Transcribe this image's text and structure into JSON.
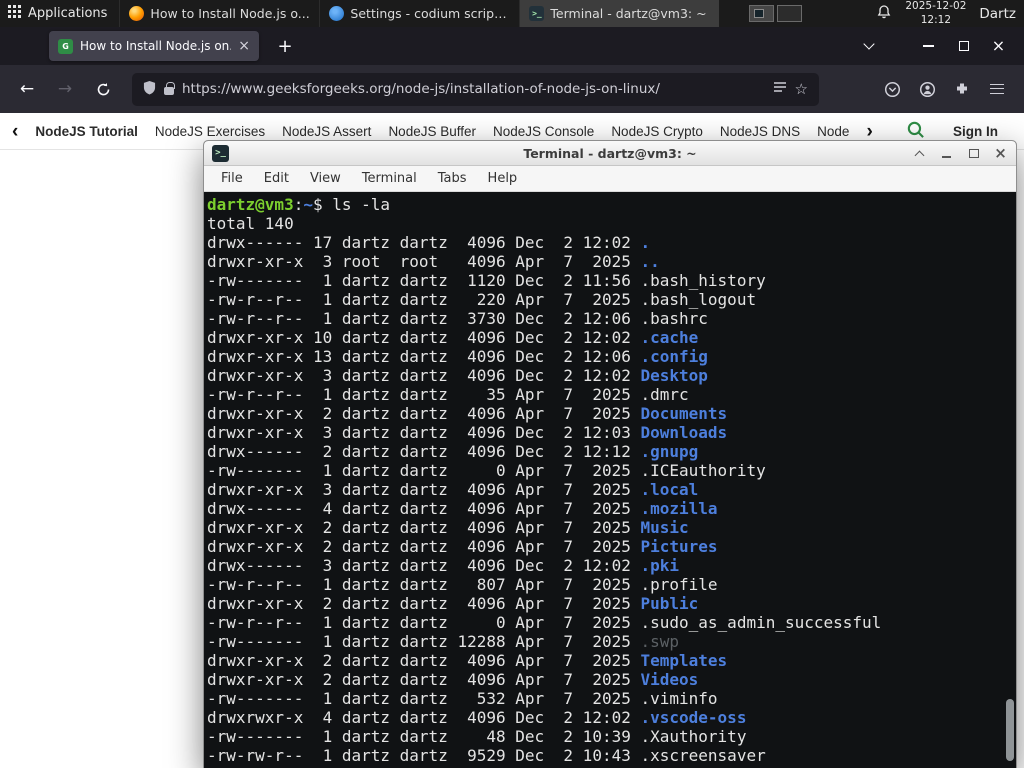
{
  "colors": {
    "gfg_green": "#2f8d46",
    "terminal_dir_blue": "#4d7fdd",
    "terminal_prompt_green": "#7ccf2e",
    "terminal_bg": "#101214",
    "firefox_toolbar": "#2b2a33",
    "panel_bg": "#1b1b1b"
  },
  "panel": {
    "applications_label": "Applications",
    "tasks": [
      {
        "icon": "firefox-icon",
        "title": "How to Install Node.js o..."
      },
      {
        "icon": "codium-icon",
        "title": "Settings - codium script..."
      },
      {
        "icon": "terminal-icon",
        "title": "Terminal - dartz@vm3: ~"
      }
    ],
    "clock": {
      "date": "2025-12-02",
      "time": "12:12"
    },
    "user_label": "Dartz"
  },
  "browser": {
    "tab_title": "How to Install Node.js on...",
    "favicon_letter": "G",
    "url": "https://www.geeksforgeeks.org/node-js/installation-of-node-js-on-linux/",
    "subnav": {
      "items": [
        "NodeJS Tutorial",
        "NodeJS Exercises",
        "NodeJS Assert",
        "NodeJS Buffer",
        "NodeJS Console",
        "NodeJS Crypto",
        "NodeJS DNS",
        "Node"
      ],
      "sign_in_label": "Sign In"
    }
  },
  "icons": {
    "back": "←",
    "forward": "→",
    "star": "☆",
    "new_tab": "+",
    "tab_close": "×",
    "window_close": "×",
    "terminal_glyph": ">_",
    "back_chevron": "‹",
    "forward_chevron": "›"
  },
  "terminal": {
    "title": "Terminal - dartz@vm3: ~",
    "menu": [
      "File",
      "Edit",
      "View",
      "Terminal",
      "Tabs",
      "Help"
    ],
    "prompt": {
      "user_host": "dartz@vm3",
      "colon": ":",
      "path": "~",
      "dollar": "$ ",
      "command": "ls -la"
    },
    "total_line": "total 140",
    "rows": [
      {
        "meta": "drwx------ 17 dartz dartz  4096 Dec  2 12:02 ",
        "name": ".",
        "type": "dir"
      },
      {
        "meta": "drwxr-xr-x  3 root  root   4096 Apr  7  2025 ",
        "name": "..",
        "type": "dir"
      },
      {
        "meta": "-rw-------  1 dartz dartz  1120 Dec  2 11:56 ",
        "name": ".bash_history",
        "type": "file"
      },
      {
        "meta": "-rw-r--r--  1 dartz dartz   220 Apr  7  2025 ",
        "name": ".bash_logout",
        "type": "file"
      },
      {
        "meta": "-rw-r--r--  1 dartz dartz  3730 Dec  2 12:06 ",
        "name": ".bashrc",
        "type": "file"
      },
      {
        "meta": "drwxr-xr-x 10 dartz dartz  4096 Dec  2 12:02 ",
        "name": ".cache",
        "type": "dir"
      },
      {
        "meta": "drwxr-xr-x 13 dartz dartz  4096 Dec  2 12:06 ",
        "name": ".config",
        "type": "dir"
      },
      {
        "meta": "drwxr-xr-x  3 dartz dartz  4096 Dec  2 12:02 ",
        "name": "Desktop",
        "type": "dir"
      },
      {
        "meta": "-rw-r--r--  1 dartz dartz    35 Apr  7  2025 ",
        "name": ".dmrc",
        "type": "file"
      },
      {
        "meta": "drwxr-xr-x  2 dartz dartz  4096 Apr  7  2025 ",
        "name": "Documents",
        "type": "dir"
      },
      {
        "meta": "drwxr-xr-x  3 dartz dartz  4096 Dec  2 12:03 ",
        "name": "Downloads",
        "type": "dir"
      },
      {
        "meta": "drwx------  2 dartz dartz  4096 Dec  2 12:12 ",
        "name": ".gnupg",
        "type": "dir"
      },
      {
        "meta": "-rw-------  1 dartz dartz     0 Apr  7  2025 ",
        "name": ".ICEauthority",
        "type": "file"
      },
      {
        "meta": "drwxr-xr-x  3 dartz dartz  4096 Apr  7  2025 ",
        "name": ".local",
        "type": "dir"
      },
      {
        "meta": "drwx------  4 dartz dartz  4096 Apr  7  2025 ",
        "name": ".mozilla",
        "type": "dir"
      },
      {
        "meta": "drwxr-xr-x  2 dartz dartz  4096 Apr  7  2025 ",
        "name": "Music",
        "type": "dir"
      },
      {
        "meta": "drwxr-xr-x  2 dartz dartz  4096 Apr  7  2025 ",
        "name": "Pictures",
        "type": "dir"
      },
      {
        "meta": "drwx------  3 dartz dartz  4096 Dec  2 12:02 ",
        "name": ".pki",
        "type": "dir"
      },
      {
        "meta": "-rw-r--r--  1 dartz dartz   807 Apr  7  2025 ",
        "name": ".profile",
        "type": "file"
      },
      {
        "meta": "drwxr-xr-x  2 dartz dartz  4096 Apr  7  2025 ",
        "name": "Public",
        "type": "dir"
      },
      {
        "meta": "-rw-r--r--  1 dartz dartz     0 Apr  7  2025 ",
        "name": ".sudo_as_admin_successful",
        "type": "file"
      },
      {
        "meta": "-rw-------  1 dartz dartz 12288 Apr  7  2025 ",
        "name": ".swp",
        "type": "dim"
      },
      {
        "meta": "drwxr-xr-x  2 dartz dartz  4096 Apr  7  2025 ",
        "name": "Templates",
        "type": "dir"
      },
      {
        "meta": "drwxr-xr-x  2 dartz dartz  4096 Apr  7  2025 ",
        "name": "Videos",
        "type": "dir"
      },
      {
        "meta": "-rw-------  1 dartz dartz   532 Apr  7  2025 ",
        "name": ".viminfo",
        "type": "file"
      },
      {
        "meta": "drwxrwxr-x  4 dartz dartz  4096 Dec  2 12:02 ",
        "name": ".vscode-oss",
        "type": "dir"
      },
      {
        "meta": "-rw-------  1 dartz dartz    48 Dec  2 10:39 ",
        "name": ".Xauthority",
        "type": "file"
      },
      {
        "meta": "-rw-rw-r--  1 dartz dartz  9529 Dec  2 10:43 ",
        "name": ".xscreensaver",
        "type": "file"
      }
    ]
  }
}
